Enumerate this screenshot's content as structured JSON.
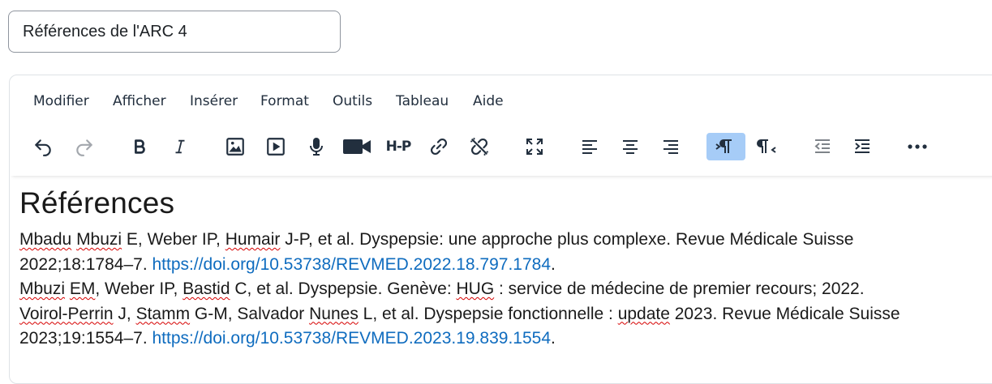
{
  "title_field": {
    "value": "Références de l'ARC 4"
  },
  "menubar": {
    "items": [
      "Modifier",
      "Afficher",
      "Insérer",
      "Format",
      "Outils",
      "Tableau",
      "Aide"
    ]
  },
  "toolbar": {
    "buttons": [
      "undo",
      "redo",
      "bold",
      "italic",
      "image",
      "media",
      "record-audio",
      "record-video",
      "h5p",
      "link",
      "unlink",
      "fullscreen",
      "align-left",
      "align-center",
      "align-right",
      "ltr",
      "rtl",
      "outdent",
      "indent",
      "more"
    ],
    "h5p_label": "H-P",
    "active": "ltr"
  },
  "content": {
    "heading": "Références",
    "ref1": {
      "a1": "Mbadu",
      "a2": "Mbuzi",
      "t1": " E, Weber IP, ",
      "a3": "Humair",
      "t2": " J-P, et al. Dyspepsie: une approche plus complexe. Revue Médicale Suisse",
      "t3": "2022;18:1784–7. ",
      "link": "https://doi.org/10.53738/REVMED.2022.18.797.1784",
      "end": "."
    },
    "ref2": {
      "a1": "Mbuzi",
      "a2": "EM",
      "t1": ", Weber IP, ",
      "a3": "Bastid",
      "t2": " C, et al. Dyspepsie. Genève: ",
      "a4": "HUG",
      "t3": " : service de médecine de premier recours; 2022."
    },
    "ref3": {
      "a1": "Voirol-Perrin",
      "t1": " J, ",
      "a2": "Stamm",
      "t2": " G-M, Salvador ",
      "a3": "Nunes",
      "t3": " L, et al. Dyspepsie fonctionnelle : ",
      "a4": "update",
      "t4": " 2023. Revue Médicale Suisse",
      "t5": "2023;19:1554–7. ",
      "link": "https://doi.org/10.53738/REVMED.2023.19.839.1554",
      "end": "."
    }
  }
}
